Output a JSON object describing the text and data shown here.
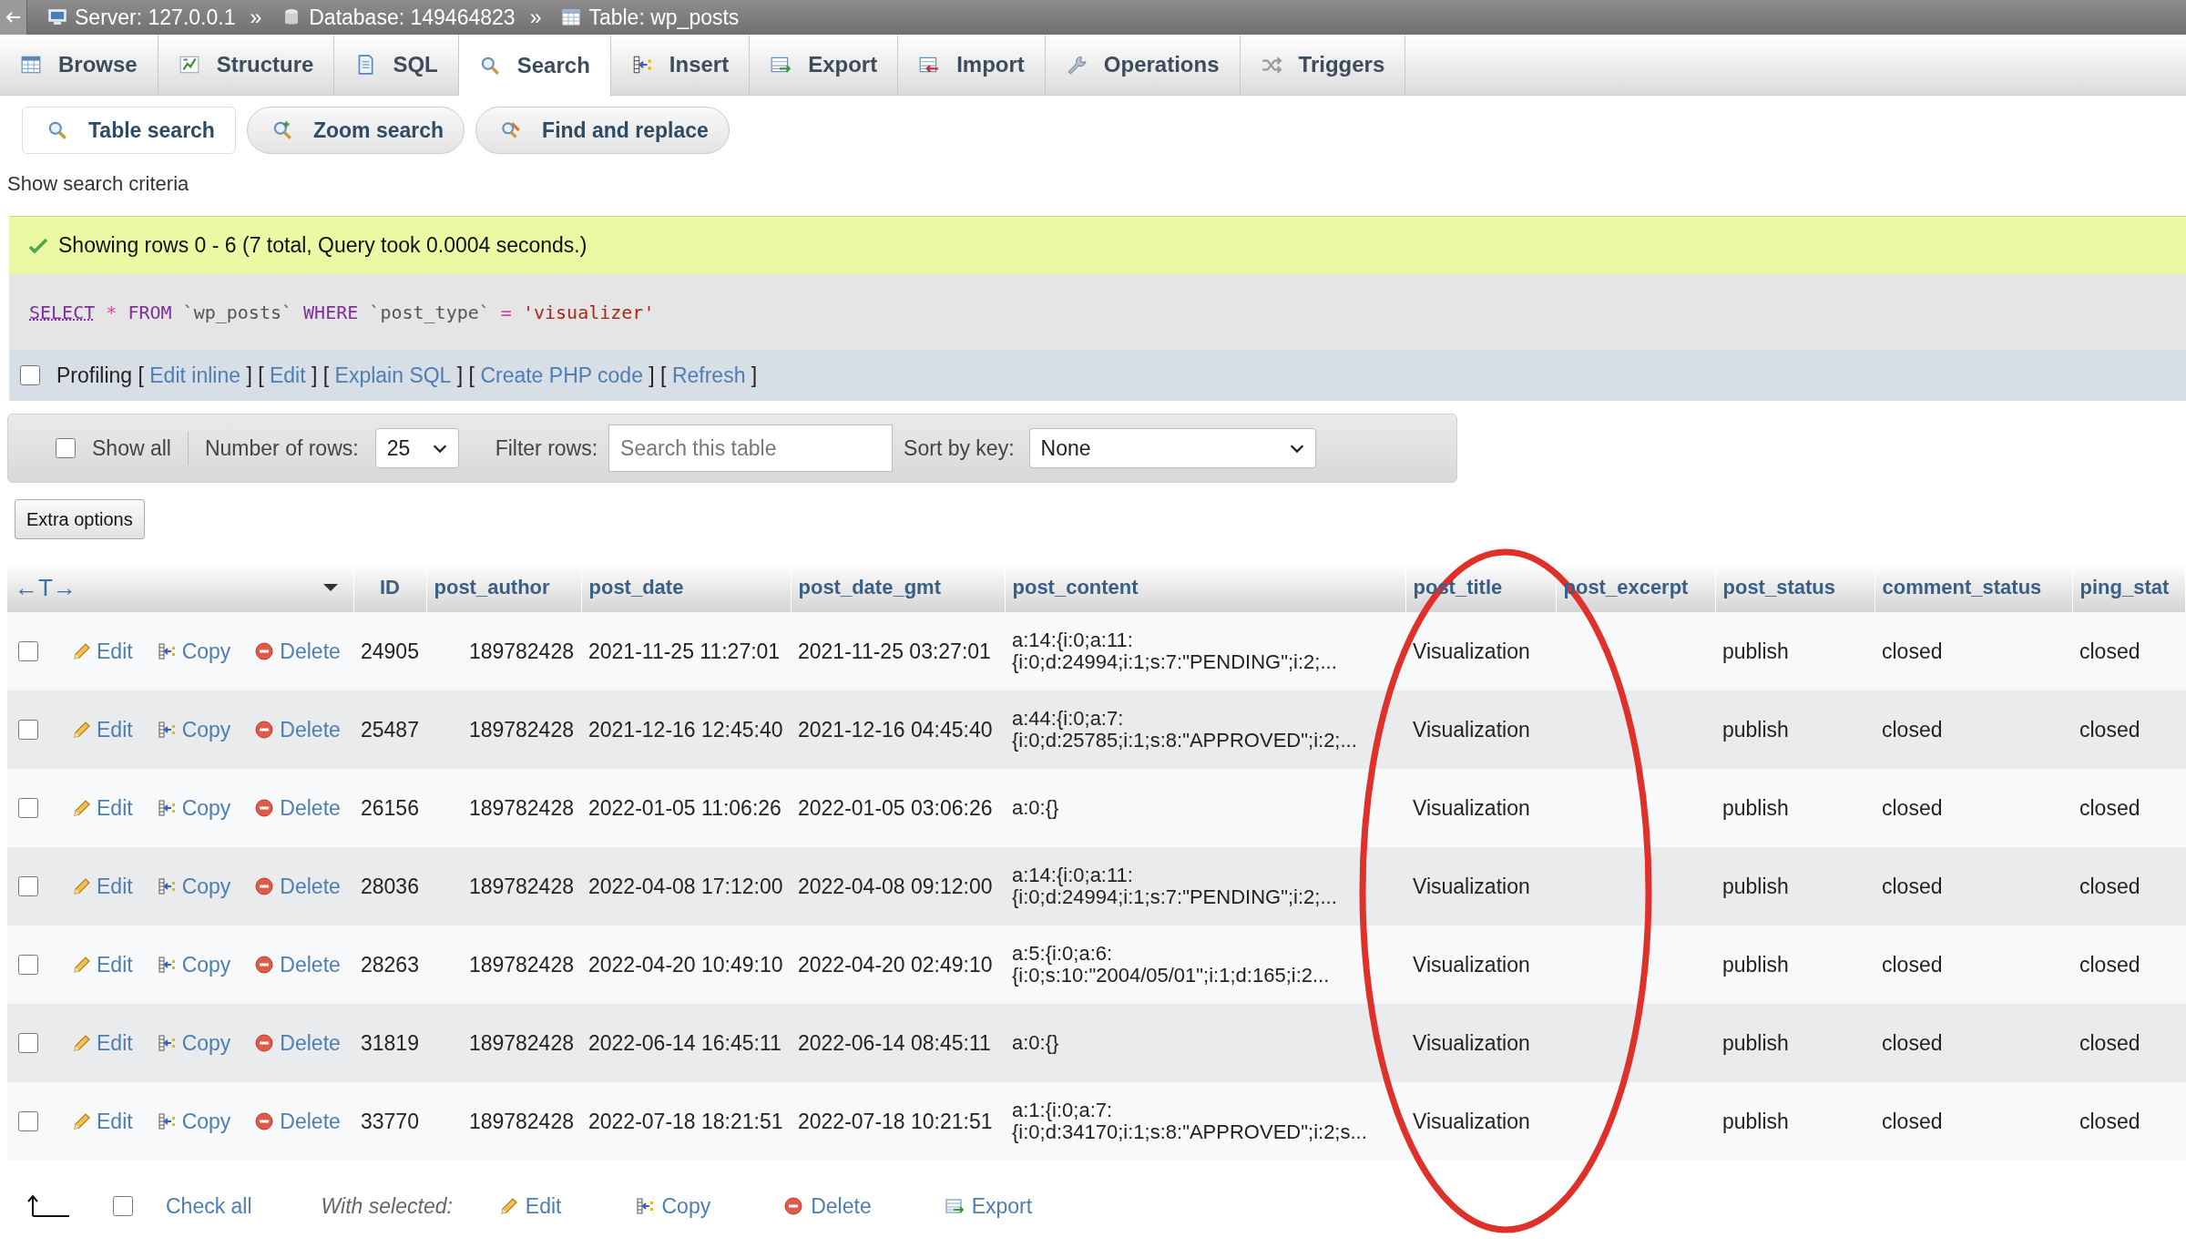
{
  "breadcrumb": [
    {
      "kind": "server",
      "label": "Server: 127.0.0.1"
    },
    {
      "kind": "database",
      "separator": "»",
      "label": "Database: 149464823"
    },
    {
      "kind": "table",
      "separator": "»",
      "label": "Table: wp_posts"
    }
  ],
  "tabs": [
    {
      "kind": "browse",
      "label": "Browse",
      "selected": false
    },
    {
      "kind": "structure",
      "label": "Structure",
      "selected": false
    },
    {
      "kind": "sql",
      "label": "SQL",
      "selected": false
    },
    {
      "kind": "search",
      "label": "Search",
      "selected": true
    },
    {
      "kind": "insert",
      "label": "Insert",
      "selected": false
    },
    {
      "kind": "export",
      "label": "Export",
      "selected": false
    },
    {
      "kind": "import",
      "label": "Import",
      "selected": false
    },
    {
      "kind": "operations",
      "label": "Operations",
      "selected": false
    },
    {
      "kind": "triggers",
      "label": "Triggers",
      "selected": false
    }
  ],
  "subtabs": [
    {
      "kind": "search",
      "label": "Table search",
      "selected": true
    },
    {
      "kind": "zoom",
      "label": "Zoom search",
      "selected": false
    },
    {
      "kind": "replace",
      "label": "Find and replace",
      "selected": false
    }
  ],
  "search_criteria_link": "Show search criteria",
  "message": "Showing rows 0 - 6 (7 total, Query took 0.0004 seconds.)",
  "sql": [
    {
      "kind": "keyword",
      "text": "SELECT"
    },
    {
      "kind": "operator",
      "text": "*"
    },
    {
      "kind": "keyword",
      "text": "FROM"
    },
    {
      "kind": "identifier",
      "text": "`wp_posts`"
    },
    {
      "kind": "keyword",
      "text": "WHERE"
    },
    {
      "kind": "identifier",
      "text": "`post_type`"
    },
    {
      "kind": "operator",
      "text": "="
    },
    {
      "kind": "string",
      "text": "'visualizer'"
    }
  ],
  "profiling": {
    "label": "Profiling",
    "checked": false,
    "links": [
      {
        "before": "[",
        "text": "Edit inline",
        "after": "]"
      },
      {
        "before": "[",
        "text": "Edit",
        "after": "]"
      },
      {
        "before": "[",
        "text": "Explain SQL",
        "after": "]"
      },
      {
        "before": "[",
        "text": "Create PHP code",
        "after": "]"
      },
      {
        "before": "[",
        "text": "Refresh",
        "after": "]"
      }
    ]
  },
  "navbar": {
    "show_all": {
      "label": "Show all",
      "checked": false
    },
    "rows_label": "Number of rows:",
    "rows_value": "25",
    "filter_label": "Filter rows:",
    "filter_placeholder": "Search this table",
    "sort_label": "Sort by key:",
    "sort_value": "None"
  },
  "extra_options": "Extra options",
  "table": {
    "column_controls": "←T→",
    "columns": [
      "ID",
      "post_author",
      "post_date",
      "post_date_gmt",
      "post_content",
      "post_title",
      "post_excerpt",
      "post_status",
      "comment_status",
      "ping_stat"
    ],
    "rows": [
      {
        "checked": false,
        "edit": "Edit",
        "copy": "Copy",
        "delete": "Delete",
        "id": "24905",
        "post_author": "189782428",
        "post_date": "2021-11-25 11:27:01",
        "post_date_gmt": "2021-11-25 03:27:01",
        "post_content": [
          "a:14:{i:0;a:11:",
          "{i:0;d:24994;i:1;s:7:\"PENDING\";i:2;..."
        ],
        "post_title": "Visualization",
        "post_status": "publish",
        "comment_status": "closed",
        "ping_stat": "closed"
      },
      {
        "checked": false,
        "edit": "Edit",
        "copy": "Copy",
        "delete": "Delete",
        "id": "25487",
        "post_author": "189782428",
        "post_date": "2021-12-16 12:45:40",
        "post_date_gmt": "2021-12-16 04:45:40",
        "post_content": [
          "a:44:{i:0;a:7:",
          "{i:0;d:25785;i:1;s:8:\"APPROVED\";i:2;..."
        ],
        "post_title": "Visualization",
        "post_status": "publish",
        "comment_status": "closed",
        "ping_stat": "closed"
      },
      {
        "checked": false,
        "edit": "Edit",
        "copy": "Copy",
        "delete": "Delete",
        "id": "26156",
        "post_author": "189782428",
        "post_date": "2022-01-05 11:06:26",
        "post_date_gmt": "2022-01-05 03:06:26",
        "post_content": [
          "a:0:{}"
        ],
        "post_title": "Visualization",
        "post_status": "publish",
        "comment_status": "closed",
        "ping_stat": "closed"
      },
      {
        "checked": false,
        "edit": "Edit",
        "copy": "Copy",
        "delete": "Delete",
        "id": "28036",
        "post_author": "189782428",
        "post_date": "2022-04-08 17:12:00",
        "post_date_gmt": "2022-04-08 09:12:00",
        "post_content": [
          "a:14:{i:0;a:11:",
          "{i:0;d:24994;i:1;s:7:\"PENDING\";i:2;..."
        ],
        "post_title": "Visualization",
        "post_status": "publish",
        "comment_status": "closed",
        "ping_stat": "closed"
      },
      {
        "checked": false,
        "edit": "Edit",
        "copy": "Copy",
        "delete": "Delete",
        "id": "28263",
        "post_author": "189782428",
        "post_date": "2022-04-20 10:49:10",
        "post_date_gmt": "2022-04-20 02:49:10",
        "post_content": [
          "a:5:{i:0;a:6:",
          "{i:0;s:10:\"2004/05/01\";i:1;d:165;i:2..."
        ],
        "post_title": "Visualization",
        "post_status": "publish",
        "comment_status": "closed",
        "ping_stat": "closed"
      },
      {
        "checked": false,
        "edit": "Edit",
        "copy": "Copy",
        "delete": "Delete",
        "id": "31819",
        "post_author": "189782428",
        "post_date": "2022-06-14 16:45:11",
        "post_date_gmt": "2022-06-14 08:45:11",
        "post_content": [
          "a:0:{}"
        ],
        "post_title": "Visualization",
        "post_status": "publish",
        "comment_status": "closed",
        "ping_stat": "closed"
      },
      {
        "checked": false,
        "edit": "Edit",
        "copy": "Copy",
        "delete": "Delete",
        "id": "33770",
        "post_author": "189782428",
        "post_date": "2022-07-18 18:21:51",
        "post_date_gmt": "2022-07-18 10:21:51",
        "post_content": [
          "a:1:{i:0;a:7:",
          "{i:0;d:34170;i:1;s:8:\"APPROVED\";i:2;s..."
        ],
        "post_title": "Visualization",
        "post_status": "publish",
        "comment_status": "closed",
        "ping_stat": "closed"
      }
    ]
  },
  "footer": {
    "check_all": {
      "label": "Check all",
      "checked": false
    },
    "with_selected": "With selected:",
    "actions": [
      {
        "kind": "edit",
        "label": "Edit"
      },
      {
        "kind": "copy",
        "label": "Copy"
      },
      {
        "kind": "delete",
        "label": "Delete"
      },
      {
        "kind": "export",
        "label": "Export"
      }
    ]
  },
  "annotation": {
    "kind": "ellipse"
  }
}
